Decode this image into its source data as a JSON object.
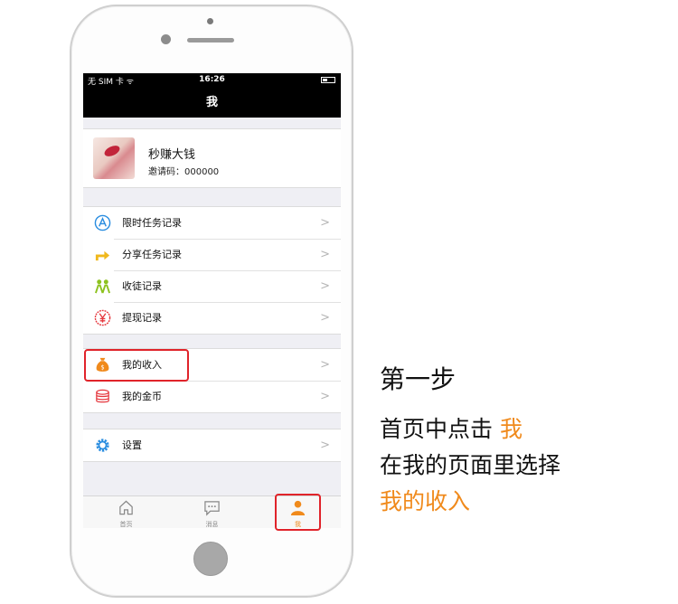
{
  "status_bar": {
    "carrier": "无 SIM 卡 ᯤ",
    "time": "16:26"
  },
  "nav": {
    "title": "我"
  },
  "profile": {
    "name": "秒赚大钱",
    "invite_code": "邀请码：000000"
  },
  "menu": {
    "group1": [
      {
        "label": "限时任务记录",
        "icon": "app-store-icon",
        "color": "#2a8de0"
      },
      {
        "label": "分享任务记录",
        "icon": "share-arrow-icon",
        "color": "#f0b81c"
      },
      {
        "label": "收徒记录",
        "icon": "people-icon",
        "color": "#8dc21f"
      },
      {
        "label": "提现记录",
        "icon": "yen-icon",
        "color": "#e5363c"
      }
    ],
    "group2": [
      {
        "label": "我的收入",
        "icon": "money-bag-icon",
        "color": "#f08a1c"
      },
      {
        "label": "我的金币",
        "icon": "coin-stack-icon",
        "color": "#e5363c"
      }
    ],
    "group3": [
      {
        "label": "设置",
        "icon": "gear-icon",
        "color": "#2a8de0"
      }
    ],
    "chevron": ">"
  },
  "tabbar": {
    "tabs": [
      {
        "label": "首页",
        "icon": "home-icon"
      },
      {
        "label": "消息",
        "icon": "message-icon"
      },
      {
        "label": "我",
        "icon": "person-icon"
      }
    ],
    "active_color": "#f08a1c"
  },
  "instructions": {
    "step_title": "第一步",
    "line1_prefix": "首页中点击",
    "line1_highlight": "我",
    "line2": "在我的页面里选择",
    "line3": "我的收入",
    "highlight_color": "#f08a1c"
  }
}
